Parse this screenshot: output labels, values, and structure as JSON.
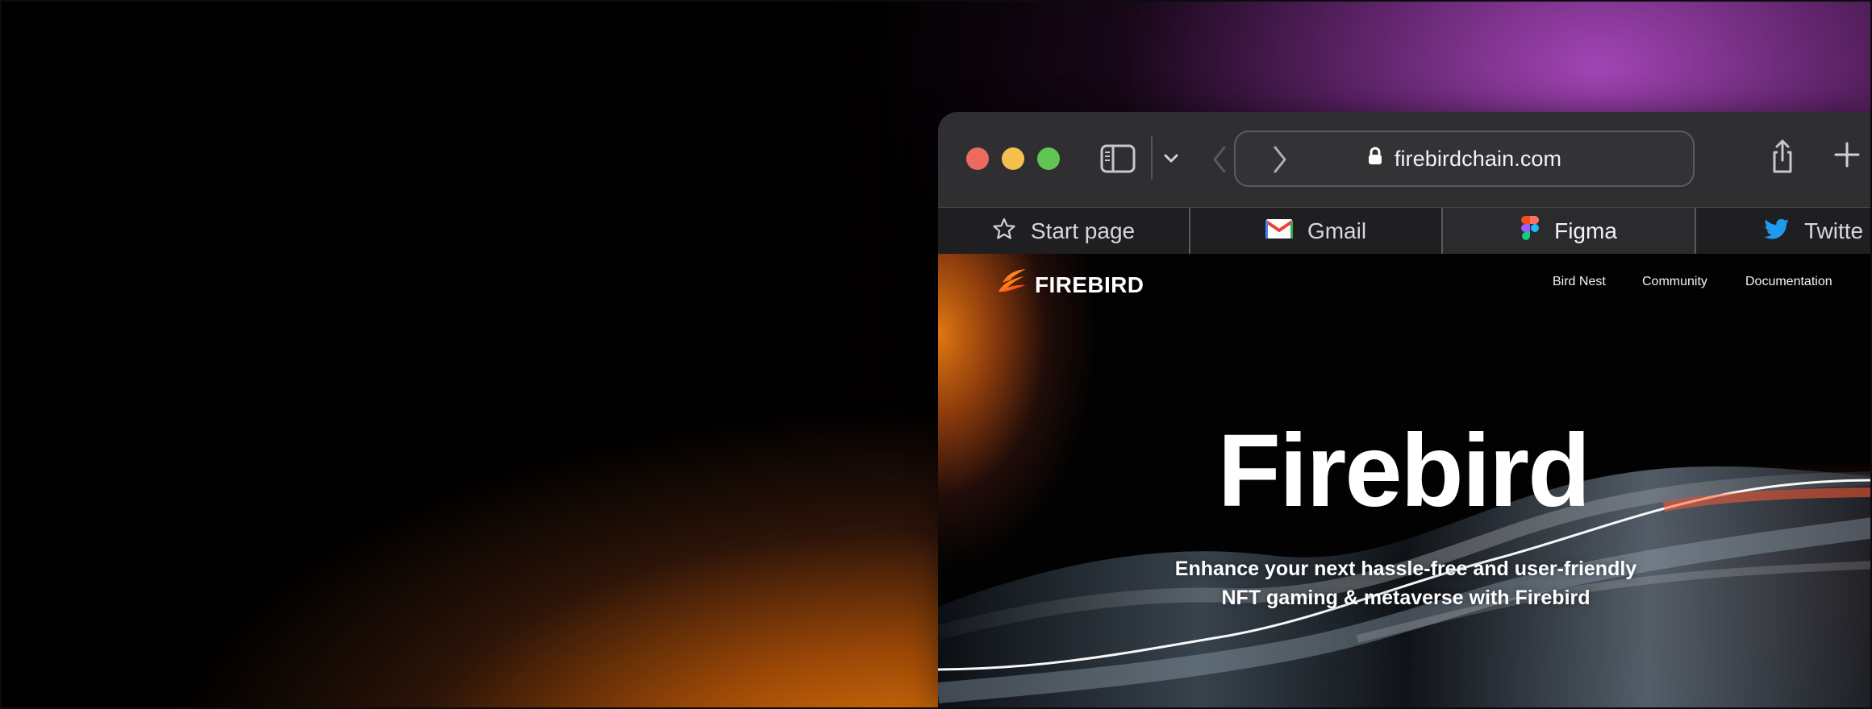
{
  "browser": {
    "address_bar": {
      "domain": "firebirdchain.com"
    },
    "tabs": [
      {
        "label": "Start page",
        "icon": "star-icon"
      },
      {
        "label": "Gmail",
        "icon": "gmail-icon"
      },
      {
        "label": "Figma",
        "icon": "figma-icon",
        "active": true
      },
      {
        "label": "Twitte",
        "icon": "twitter-icon"
      }
    ],
    "toolbar_icons": {
      "sidebar": "sidebar-icon",
      "tab_menu": "chevron-down-icon",
      "back": "chevron-left-icon",
      "forward": "chevron-right-icon",
      "share": "share-icon",
      "new_tab": "plus-icon",
      "secure": "lock-icon"
    },
    "traffic_lights": [
      "#ed6a5e",
      "#f4bf4f",
      "#61c554"
    ]
  },
  "site": {
    "brand": "FIREBIRD",
    "nav": {
      "bird_nest": "Bird Nest",
      "community": "Community",
      "documentation": "Documentation"
    },
    "hero": {
      "title": "Firebird",
      "subtitle_line1": "Enhance your next hassle-free and user-friendly",
      "subtitle_line2": "NFT gaming & metaverse with Firebird"
    }
  },
  "colors": {
    "accent_orange": "#e47b0b",
    "accent_purple": "#9b3fb0",
    "toolbar": "#2f2f31",
    "tab_active": "#2b2b2d"
  }
}
